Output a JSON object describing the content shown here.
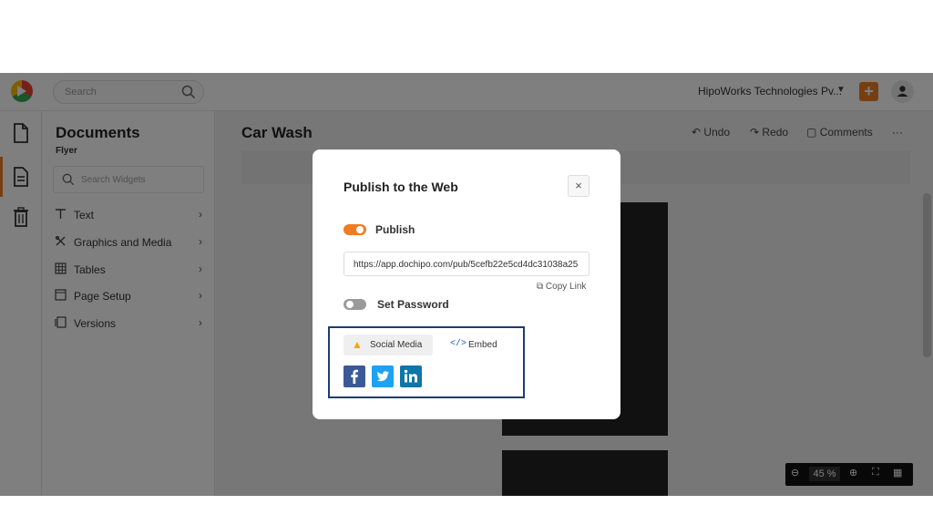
{
  "topbar": {
    "search_placeholder": "Search",
    "company": "HipoWorks Technologies Pv...",
    "add_label": "+"
  },
  "panel": {
    "title": "Documents",
    "subtitle": "Flyer",
    "widget_search_placeholder": "Search Widgets",
    "items": [
      {
        "label": "Text",
        "icon": "text-icon"
      },
      {
        "label": "Graphics and Media",
        "icon": "graphics-icon"
      },
      {
        "label": "Tables",
        "icon": "table-icon"
      },
      {
        "label": "Page Setup",
        "icon": "page-setup-icon"
      },
      {
        "label": "Versions",
        "icon": "versions-icon"
      }
    ]
  },
  "editor": {
    "doc_title": "Car Wash",
    "undo": "Undo",
    "redo": "Redo",
    "comments": "Comments",
    "more": "···",
    "zoom_value": "45",
    "zoom_unit": "%"
  },
  "modal": {
    "title": "Publish to the Web",
    "close": "×",
    "publish_label": "Publish",
    "publish_on": true,
    "url": "https://app.dochipo.com/pub/5cefb22e5cd4dc31038a25",
    "copy_link": "Copy Link",
    "password_label": "Set Password",
    "password_on": false,
    "tabs": {
      "social": "Social Media",
      "embed": "Embed"
    },
    "social": [
      {
        "name": "facebook-icon",
        "glyph": "f",
        "color": "#3b5998"
      },
      {
        "name": "twitter-icon",
        "glyph": "t",
        "color": "#1da1f2"
      },
      {
        "name": "linkedin-icon",
        "glyph": "in",
        "color": "#0e76a8"
      }
    ]
  },
  "colors": {
    "accent": "#f07c21",
    "highlight_box": "#1f3c72"
  }
}
